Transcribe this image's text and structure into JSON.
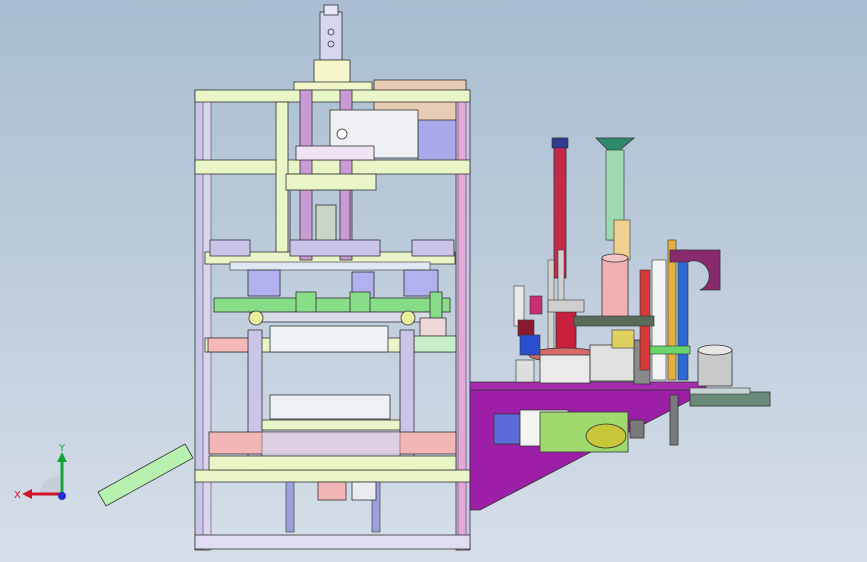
{
  "viewport": {
    "background_top": "#a8bdd1",
    "background_bottom": "#d6dfe9"
  },
  "triad": {
    "x_label": "X",
    "y_label": "Y",
    "x_color": "#d0142c",
    "y_color": "#17a23a",
    "z_color": "#1b2fd6"
  },
  "parts": {
    "frame_color": "#c9c4e8",
    "frame_light": "#e0f0c9",
    "purple_base": "#9d1fa8",
    "green_pipe": "#88dd88",
    "pink_plate": "#f2b6b6",
    "red_column": "#c42a48",
    "teal_column": "#2d8b6c",
    "olive_part": "#c8c73a",
    "blue_box": "#5a6bd8",
    "chute_color": "#b8f0b0"
  }
}
